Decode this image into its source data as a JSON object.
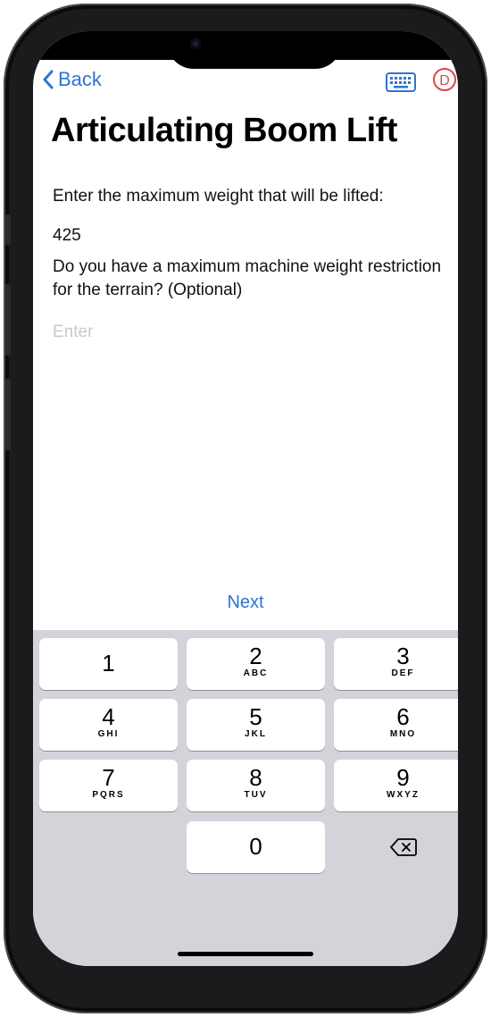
{
  "nav": {
    "back_label": "Back",
    "profile_initial": "D"
  },
  "page": {
    "title": "Articulating Boom Lift",
    "question1": "Enter the maximum weight that will be lifted:",
    "answer1": "425",
    "question2": "Do you have a maximum machine weight restriction for the terrain? (Optional)",
    "answer2_placeholder": "Enter",
    "next_label": "Next"
  },
  "keypad": {
    "keys": [
      {
        "digit": "1",
        "letters": ""
      },
      {
        "digit": "2",
        "letters": "ABC"
      },
      {
        "digit": "3",
        "letters": "DEF"
      },
      {
        "digit": "4",
        "letters": "GHI"
      },
      {
        "digit": "5",
        "letters": "JKL"
      },
      {
        "digit": "6",
        "letters": "MNO"
      },
      {
        "digit": "7",
        "letters": "PQRS"
      },
      {
        "digit": "8",
        "letters": "TUV"
      },
      {
        "digit": "9",
        "letters": "WXYZ"
      },
      {
        "digit": "0",
        "letters": ""
      }
    ]
  },
  "colors": {
    "accent": "#2f73d4",
    "profile": "#d84848",
    "keypad_bg": "#d2d4d9"
  },
  "icons": [
    "chevron-left-icon",
    "keyboard-icon",
    "profile-icon",
    "backspace-icon"
  ]
}
